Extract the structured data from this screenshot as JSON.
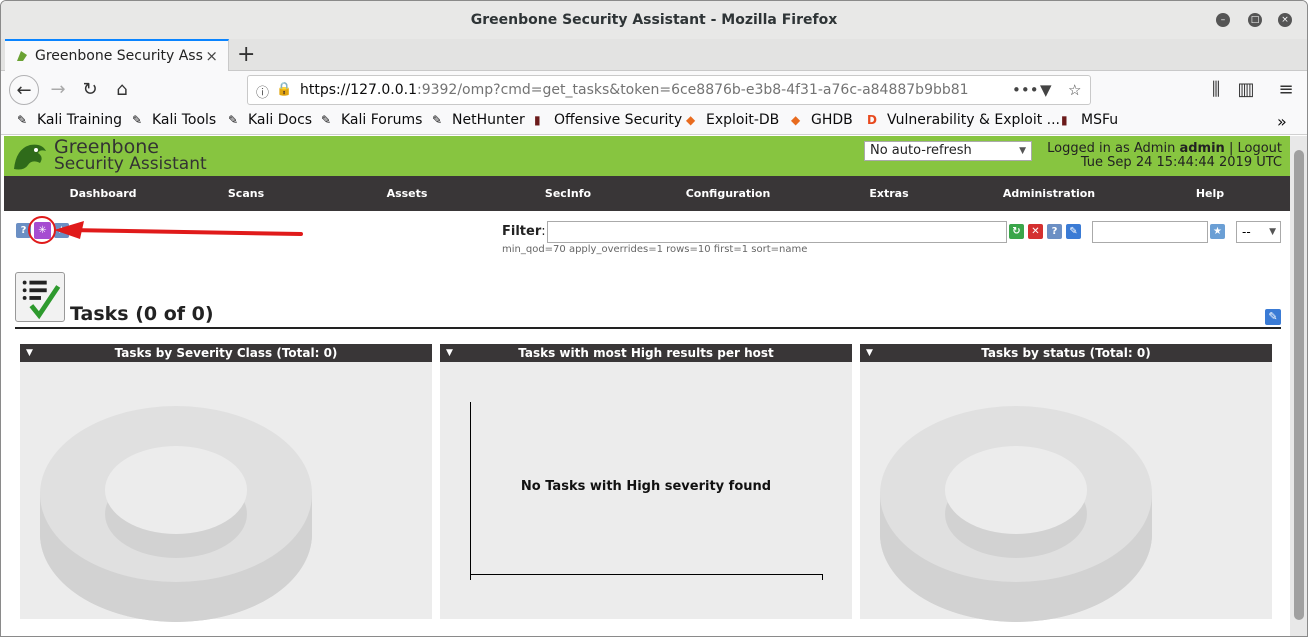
{
  "window": {
    "title": "Greenbone Security Assistant - Mozilla Firefox"
  },
  "tab": {
    "label": "Greenbone Security Assis",
    "close": "×",
    "new_tab": "+"
  },
  "nav": {
    "url_host": "https://127.0.0.1",
    "url_rest": ":9392/omp?cmd=get_tasks&token=6ce8876b-e3b8-4f31-a76c-a84887b9bb81"
  },
  "bookmarks": [
    {
      "label": "Kali Training"
    },
    {
      "label": "Kali Tools"
    },
    {
      "label": "Kali Docs"
    },
    {
      "label": "Kali Forums"
    },
    {
      "label": "NetHunter"
    },
    {
      "label": "Offensive Security"
    },
    {
      "label": "Exploit-DB"
    },
    {
      "label": "GHDB"
    },
    {
      "label": "Vulnerability & Exploit ..."
    },
    {
      "label": "MSFu"
    }
  ],
  "header": {
    "logo_line1": "Greenbone",
    "logo_line2": "Security Assistant",
    "refresh_option": "No auto-refresh",
    "logged_in_as": "Logged in as",
    "role": "Admin",
    "user": "admin",
    "separator": "|",
    "logout": "Logout",
    "datetime": "Tue Sep 24 15:44:44 2019 UTC"
  },
  "menu": [
    {
      "label": "Dashboard"
    },
    {
      "label": "Scans"
    },
    {
      "label": "Assets"
    },
    {
      "label": "SecInfo"
    },
    {
      "label": "Configuration"
    },
    {
      "label": "Extras"
    },
    {
      "label": "Administration"
    },
    {
      "label": "Help"
    }
  ],
  "filter": {
    "label": "Filter",
    "colon": ":",
    "value": "",
    "hint": "min_qod=70 apply_overrides=1 rows=10 first=1 sort=name",
    "name_value": "",
    "select_value": "--"
  },
  "tasks": {
    "title": "Tasks (0 of 0)"
  },
  "panels": [
    {
      "title": "Tasks by Severity Class (Total: 0)"
    },
    {
      "title": "Tasks with most High results per host",
      "empty_text": "No Tasks with High severity found"
    },
    {
      "title": "Tasks by status (Total: 0)"
    }
  ],
  "colors": {
    "header_green": "#87c540",
    "menu_dark": "#393637",
    "annotation_red": "#e01a1a"
  }
}
